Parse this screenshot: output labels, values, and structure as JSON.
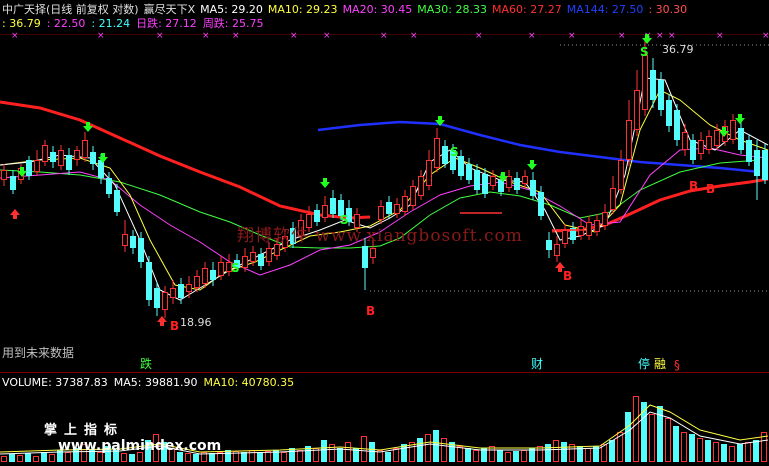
{
  "header": {
    "row1": [
      {
        "text": "中广天择(日线 前复权 对数)",
        "color": "#e0e0e0"
      },
      {
        "text": "赢尽天下X",
        "color": "#e0e0e0"
      },
      {
        "text": "MA5: 29.20",
        "color": "#ffffff"
      },
      {
        "text": "MA10: 29.23",
        "color": "#ffff40"
      },
      {
        "text": "MA20: 30.45",
        "color": "#ff40ff"
      },
      {
        "text": "MA30: 28.33",
        "color": "#40ff40"
      },
      {
        "text": "MA60: 27.27",
        "color": "#ff3030"
      },
      {
        "text": "MA144: 27.50",
        "color": "#2040ff"
      },
      {
        "text": ": 30.30",
        "color": "#ff5050"
      }
    ],
    "row2": [
      {
        "text": ": 36.79",
        "color": "#ffff40"
      },
      {
        "text": ": 22.50",
        "color": "#ff40ff"
      },
      {
        "text": ": 21.24",
        "color": "#40ffff"
      },
      {
        "text": "日跌: 27.12",
        "color": "#ff40ff"
      },
      {
        "text": "周跌: 25.75",
        "color": "#ff40ff"
      }
    ]
  },
  "labels": {
    "high_price": "36.79",
    "low_price": "18.96",
    "future_data_note": "用到未来数据",
    "tag_die": "跌",
    "tag_cai": "财",
    "tag_ting": "停",
    "tag_rong": "融",
    "tag_s": "§",
    "signal_b": "B",
    "signal_s": "S",
    "watermark": "翔博软件 www.xiangbosoft.com",
    "watermark2": "www.palmindex.com",
    "watermark3": "掌上指标"
  },
  "volume_header": [
    {
      "text": "VOLUME: 37387.83",
      "color": "#ffffff"
    },
    {
      "text": "MA5: 39881.90",
      "color": "#ffffff"
    },
    {
      "text": "MA10: 40780.35",
      "color": "#ffff40"
    }
  ],
  "colors": {
    "up": "#ff3232",
    "down": "#54fcfc",
    "ma5": "#ffffff",
    "ma10": "#ffff40",
    "ma20": "#ff40ff",
    "ma30": "#40ff40",
    "ma60": "#ff2020",
    "ma144": "#2030ff",
    "grid": "#800000"
  },
  "chart_data": {
    "type": "candlestick",
    "price_high": 36.79,
    "price_low": 18.96,
    "last_volume": 37387.83,
    "ma_values": {
      "MA5": 29.2,
      "MA10": 29.23,
      "MA20": 30.45,
      "MA30": 28.33,
      "MA60": 27.27,
      "MA144": 27.5
    }
  }
}
